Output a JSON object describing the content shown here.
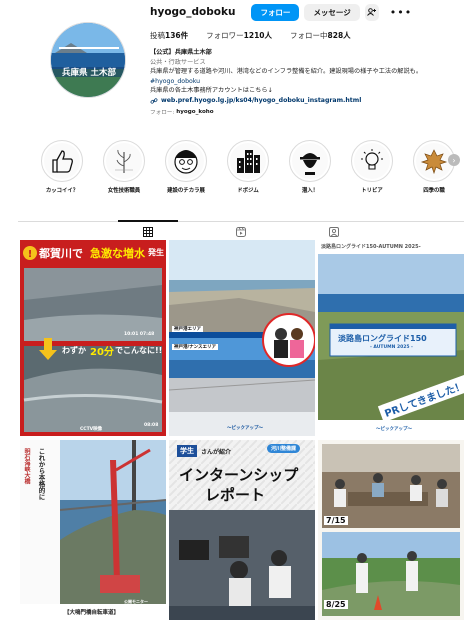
{
  "profile": {
    "username": "hyogo_doboku",
    "follow_label": "フォロー",
    "message_label": "メッセージ",
    "add_label": "+",
    "avatar_text": "兵庫県 土木部",
    "posts": "136件",
    "posts_label": "投稿",
    "followers": "1210人",
    "followers_label": "フォロワー",
    "following": "828人",
    "following_label": "フォロー中",
    "full_name": "【公式】兵庫県土木部",
    "category": "公共・行政サービス",
    "bio_line1": "兵庫県が管理する道路や河川、港湾などのインフラ整備を紹介。建設現場の様子や工法の解説も。",
    "bio_tag": "#hyogo_doboku",
    "bio_line2": "兵庫県の各土木事務所アカウントはこちら↓",
    "link": "web.pref.hyogo.lg.jp/ks04/hyogo_doboku_instagram.html",
    "followed_by_label": "フォロー:",
    "followed_by": "hyogo_koho"
  },
  "highlights": [
    {
      "label": "カッコイイ？",
      "icon": "thumbs-up"
    },
    {
      "label": "女性技術職員",
      "icon": "plant-sketch"
    },
    {
      "label": "建設のチカラ展",
      "icon": "character"
    },
    {
      "label": "ドボジム",
      "icon": "buildings"
    },
    {
      "label": "潜入！",
      "icon": "detective"
    },
    {
      "label": "トリビア",
      "icon": "lightbulb"
    },
    {
      "label": "四季の職",
      "icon": "leaf"
    }
  ],
  "tabs": [
    {
      "name": "posts",
      "icon": "grid-icon"
    },
    {
      "name": "reels",
      "icon": "reels-icon"
    },
    {
      "name": "tagged",
      "icon": "tagged-icon"
    }
  ],
  "posts": {
    "p1_title1": "都賀川で",
    "p1_title2": "急激な増水",
    "p1_title3": "発生",
    "p1_time1": "10:01 07:48",
    "p1_sub": "わずか",
    "p1_min": "20分",
    "p1_sub2": "でこんなに!!",
    "p1_time2": "08:08",
    "p1_caption": "CCTV映像",
    "p2_tag1": "神戸港エリア",
    "p2_tag2": "神戸港/ナンスエリア",
    "p2_footer": "〜ピックアップ〜",
    "p3_header": "淡路島ロングライド150-AUTUMN 2025-",
    "p3_banner": "淡路島ロングライド150",
    "p3_banner_sub": "- AUTUMN 2025 -",
    "p3_pr": "PRしてきました！",
    "p3_footer": "〜ピックアップ〜",
    "p4_vertical1": "これから本格的に",
    "p4_vertical2": "明石海峡大橋",
    "p4_caption": "【大鳴門橋自転車道】",
    "p4_badge": "公開モニター",
    "p5_name_badge": "学生",
    "p5_by": "さんが紹介",
    "p5_pill": "河川整備課",
    "p5_title1": "インターンシップ",
    "p5_title2": "レポート",
    "p6_date1": "7/15",
    "p6_date2": "8/25"
  }
}
